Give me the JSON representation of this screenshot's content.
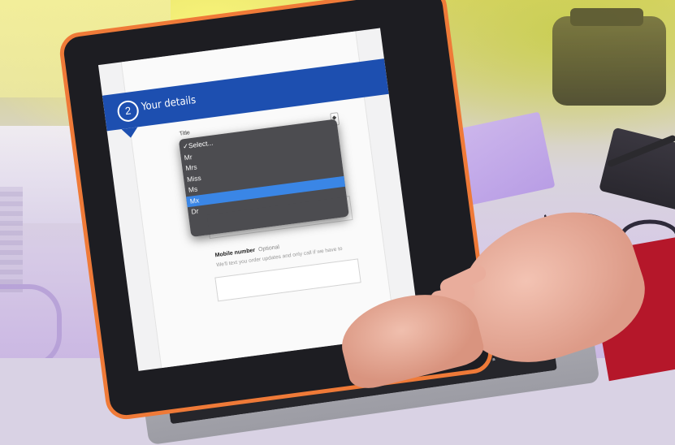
{
  "form": {
    "step_number": "2",
    "step_title": "Your details",
    "title_field_label": "Title",
    "title_options": [
      "Select...",
      "Mr",
      "Mrs",
      "Miss",
      "Ms",
      "Mx",
      "Dr"
    ],
    "title_selected_option": "Select...",
    "title_highlighted_option": "Mx",
    "mobile_label": "Mobile number",
    "mobile_optional": "Optional",
    "mobile_hint": "We'll text you order updates and only call if we have to"
  },
  "colors": {
    "banner_blue": "#1d4fb0",
    "highlight_blue": "#3a86e6",
    "laptop_edge_orange": "#ef7a38",
    "sleeve_red": "#b5172a"
  },
  "icons": [
    "checkmark-icon",
    "select-arrow-icon"
  ]
}
